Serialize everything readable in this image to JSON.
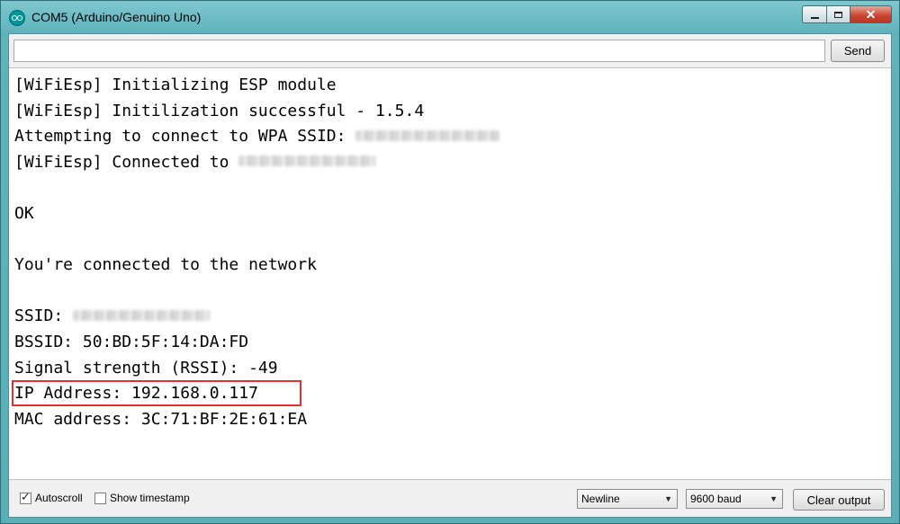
{
  "window": {
    "title": "COM5 (Arduino/Genuino Uno)",
    "close_glyph": "✕"
  },
  "send": {
    "input_value": "",
    "button_label": "Send"
  },
  "console": {
    "lines": [
      {
        "text": "[WiFiEsp] Initializing ESP module"
      },
      {
        "text": "[WiFiEsp] Initilization successful - 1.5.4"
      },
      {
        "text": "Attempting to connect to WPA SSID: ",
        "redacted": true
      },
      {
        "text": "[WiFiEsp] Connected to ",
        "redacted": true
      },
      {
        "text": ""
      },
      {
        "text": "OK"
      },
      {
        "text": ""
      },
      {
        "text": "You're connected to the network"
      },
      {
        "text": ""
      },
      {
        "text": "SSID: ",
        "redacted": true
      },
      {
        "text": "BSSID: 50:BD:5F:14:DA:FD"
      },
      {
        "text": "Signal strength (RSSI): -49"
      },
      {
        "text": "IP Address: 192.168.0.117",
        "highlighted": true
      },
      {
        "text": "MAC address: 3C:71:BF:2E:61:EA"
      }
    ]
  },
  "footer": {
    "autoscroll_label": "Autoscroll",
    "autoscroll_checked": true,
    "timestamp_label": "Show timestamp",
    "timestamp_checked": false,
    "line_ending": "Newline",
    "baud_rate": "9600 baud",
    "clear_label": "Clear output"
  },
  "colors": {
    "highlight": "#e03030",
    "titlebar": "#5fb3bc"
  }
}
